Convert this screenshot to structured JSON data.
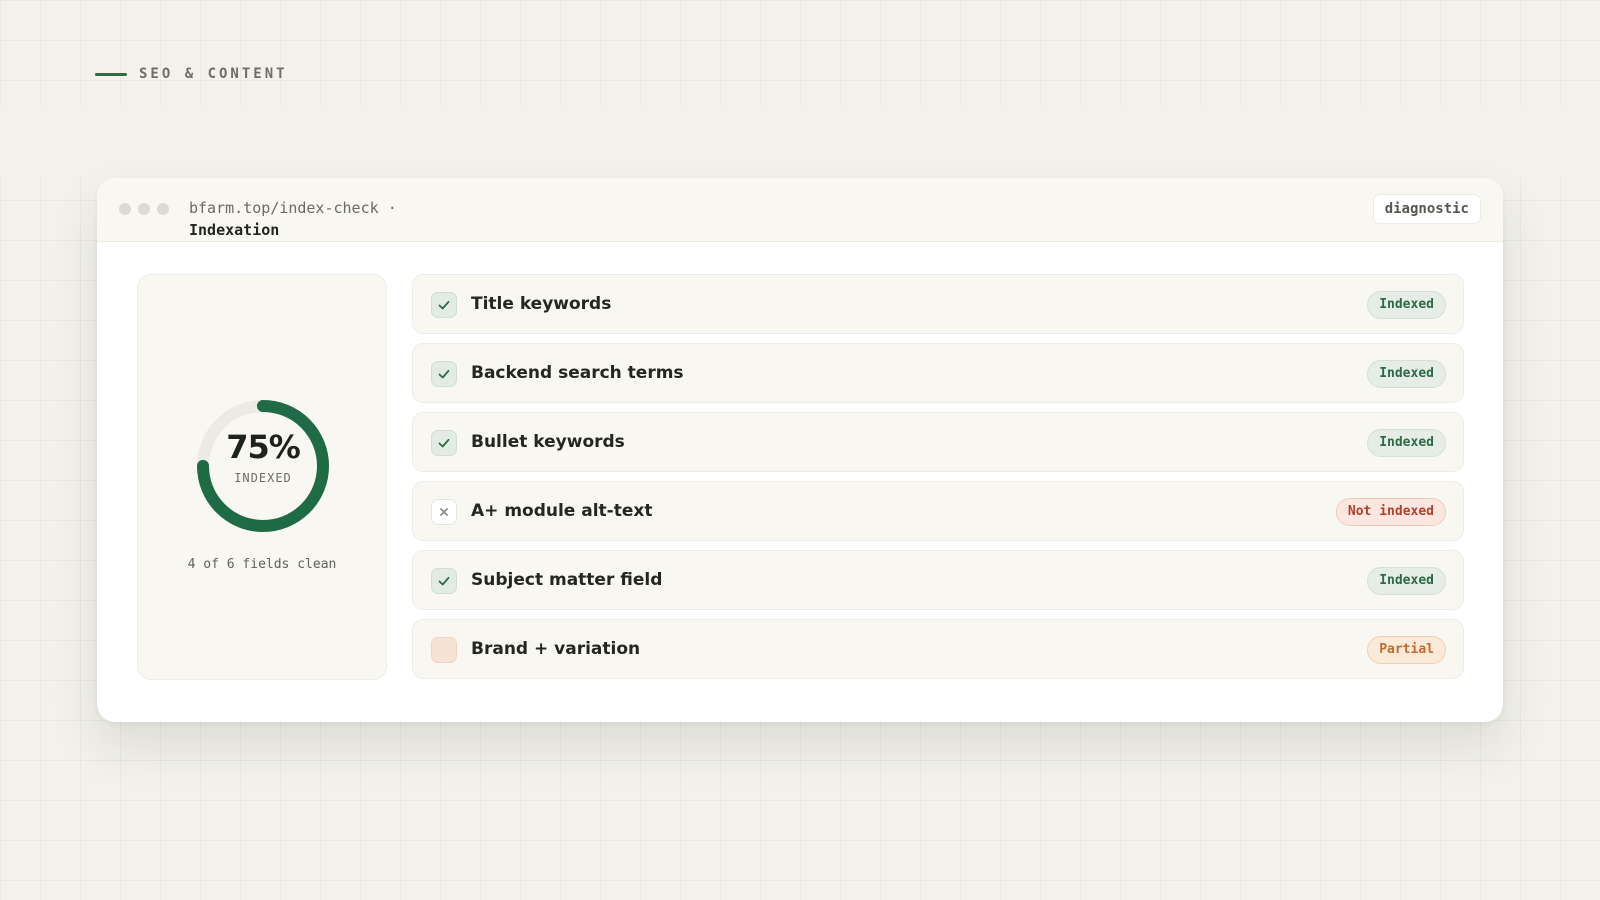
{
  "eyebrow": {
    "label": "SEO & CONTENT",
    "accent_color": "#2f6b48"
  },
  "window": {
    "url": "bfarm.top/index-check",
    "separator": "·",
    "page_name": "Indexation",
    "tag": "diagnostic"
  },
  "score": {
    "percent": 75,
    "percent_text": "75%",
    "label": "INDEXED",
    "summary": "4 of 6 fields clean",
    "ring_color": "#1f6b45",
    "track_color": "#ecebe3"
  },
  "fields": [
    {
      "label": "Title keywords",
      "status": "Indexed",
      "state": "ok",
      "icon": "check-icon"
    },
    {
      "label": "Backend search terms",
      "status": "Indexed",
      "state": "ok",
      "icon": "check-icon"
    },
    {
      "label": "Bullet keywords",
      "status": "Indexed",
      "state": "ok",
      "icon": "check-icon"
    },
    {
      "label": "A+ module alt-text",
      "status": "Not indexed",
      "state": "bad",
      "icon": "x-icon"
    },
    {
      "label": "Subject matter field",
      "status": "Indexed",
      "state": "ok",
      "icon": "check-icon"
    },
    {
      "label": "Brand + variation",
      "status": "Partial",
      "state": "part",
      "icon": "partial-icon"
    }
  ],
  "colors": {
    "indexed": "#2a6b45",
    "not_indexed": "#b2412c",
    "partial": "#c26b2a"
  }
}
